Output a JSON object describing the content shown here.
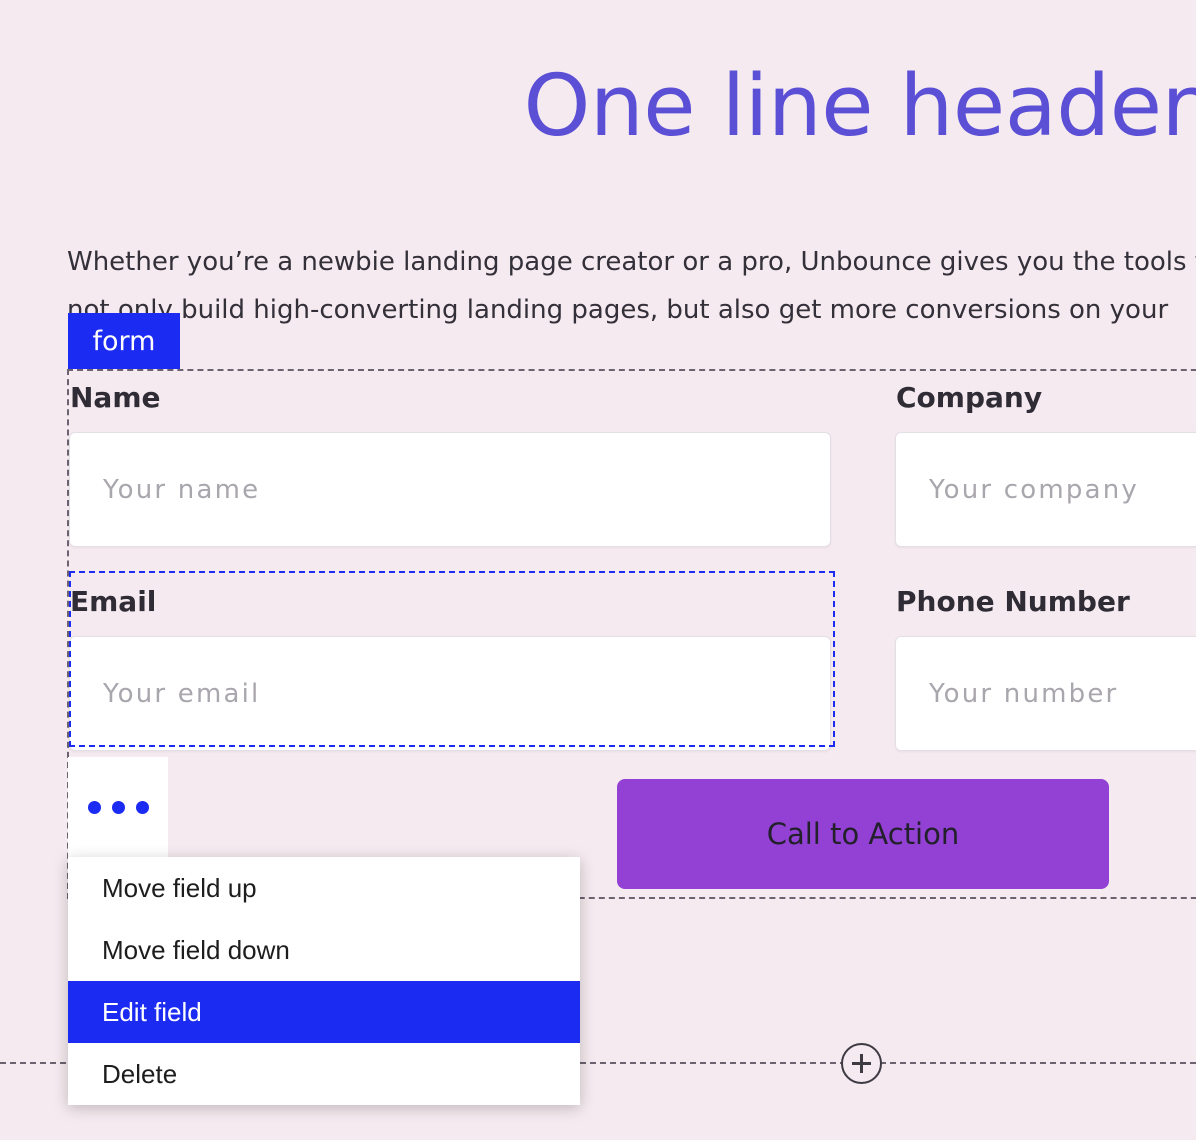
{
  "colors": {
    "page_background": "#f5eaef",
    "heading": "#5b4fd6",
    "accent_blue": "#1b2bf2",
    "cta_purple": "#9341d4",
    "body_text": "#33303a",
    "placeholder": "#a9a6ad",
    "dashed_guide": "#6b6470"
  },
  "hero": {
    "title": "One line header"
  },
  "intro": {
    "paragraph": "Whether you’re a newbie landing page creator or a pro, Unbounce gives you the tools to not only build high-converting landing pages, but also get more conversions on your website."
  },
  "form": {
    "badge_label": "form",
    "fields": [
      {
        "label": "Name",
        "placeholder": "Your name",
        "value": "",
        "selected": false
      },
      {
        "label": "Company",
        "placeholder": "Your company",
        "value": "",
        "selected": false
      },
      {
        "label": "Email",
        "placeholder": "Your email",
        "value": "",
        "selected": true
      },
      {
        "label": "Phone Number",
        "placeholder": "Your number",
        "value": "",
        "selected": false
      }
    ],
    "cta_label": "Call to Action"
  },
  "field_menu": {
    "trigger_icon": "three-dots-icon",
    "items": [
      {
        "label": "Move field up",
        "active": false
      },
      {
        "label": "Move field down",
        "active": false
      },
      {
        "label": "Edit field",
        "active": true
      },
      {
        "label": "Delete",
        "active": false
      }
    ]
  },
  "section_divider": {
    "add_icon": "plus-circle-icon"
  }
}
